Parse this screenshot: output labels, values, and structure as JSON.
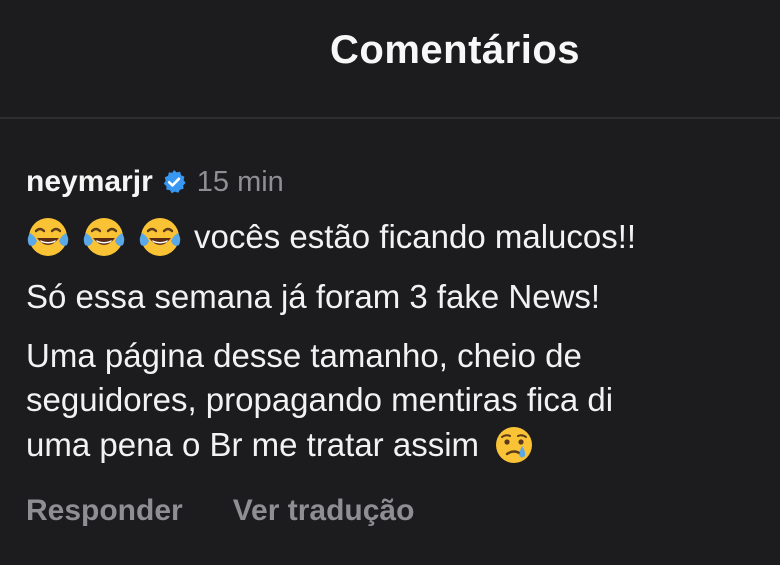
{
  "header": {
    "title": "Comentários"
  },
  "comment": {
    "username": "neymarjr",
    "verified_icon": "verified-badge-icon",
    "time": "15 min",
    "line1_emojis": [
      "face-with-tears-of-joy-icon",
      "face-with-tears-of-joy-icon",
      "face-with-tears-of-joy-icon"
    ],
    "line1_text": "vocês estão ficando malucos!!",
    "line2_text": "Só essa semana já foram 3 fake News!",
    "line3_text": "Uma página desse tamanho, cheio de",
    "line4_text": "seguidores, propagando mentiras fica di",
    "line5_text": "uma pena o Br me tratar assim",
    "line5_emoji": "crying-face-icon"
  },
  "actions": {
    "reply": "Responder",
    "translate": "Ver tradução"
  },
  "colors": {
    "background": "#1c1c1e",
    "text": "#f5f5f5",
    "muted": "#8e8e93",
    "verified": "#3897f0"
  }
}
